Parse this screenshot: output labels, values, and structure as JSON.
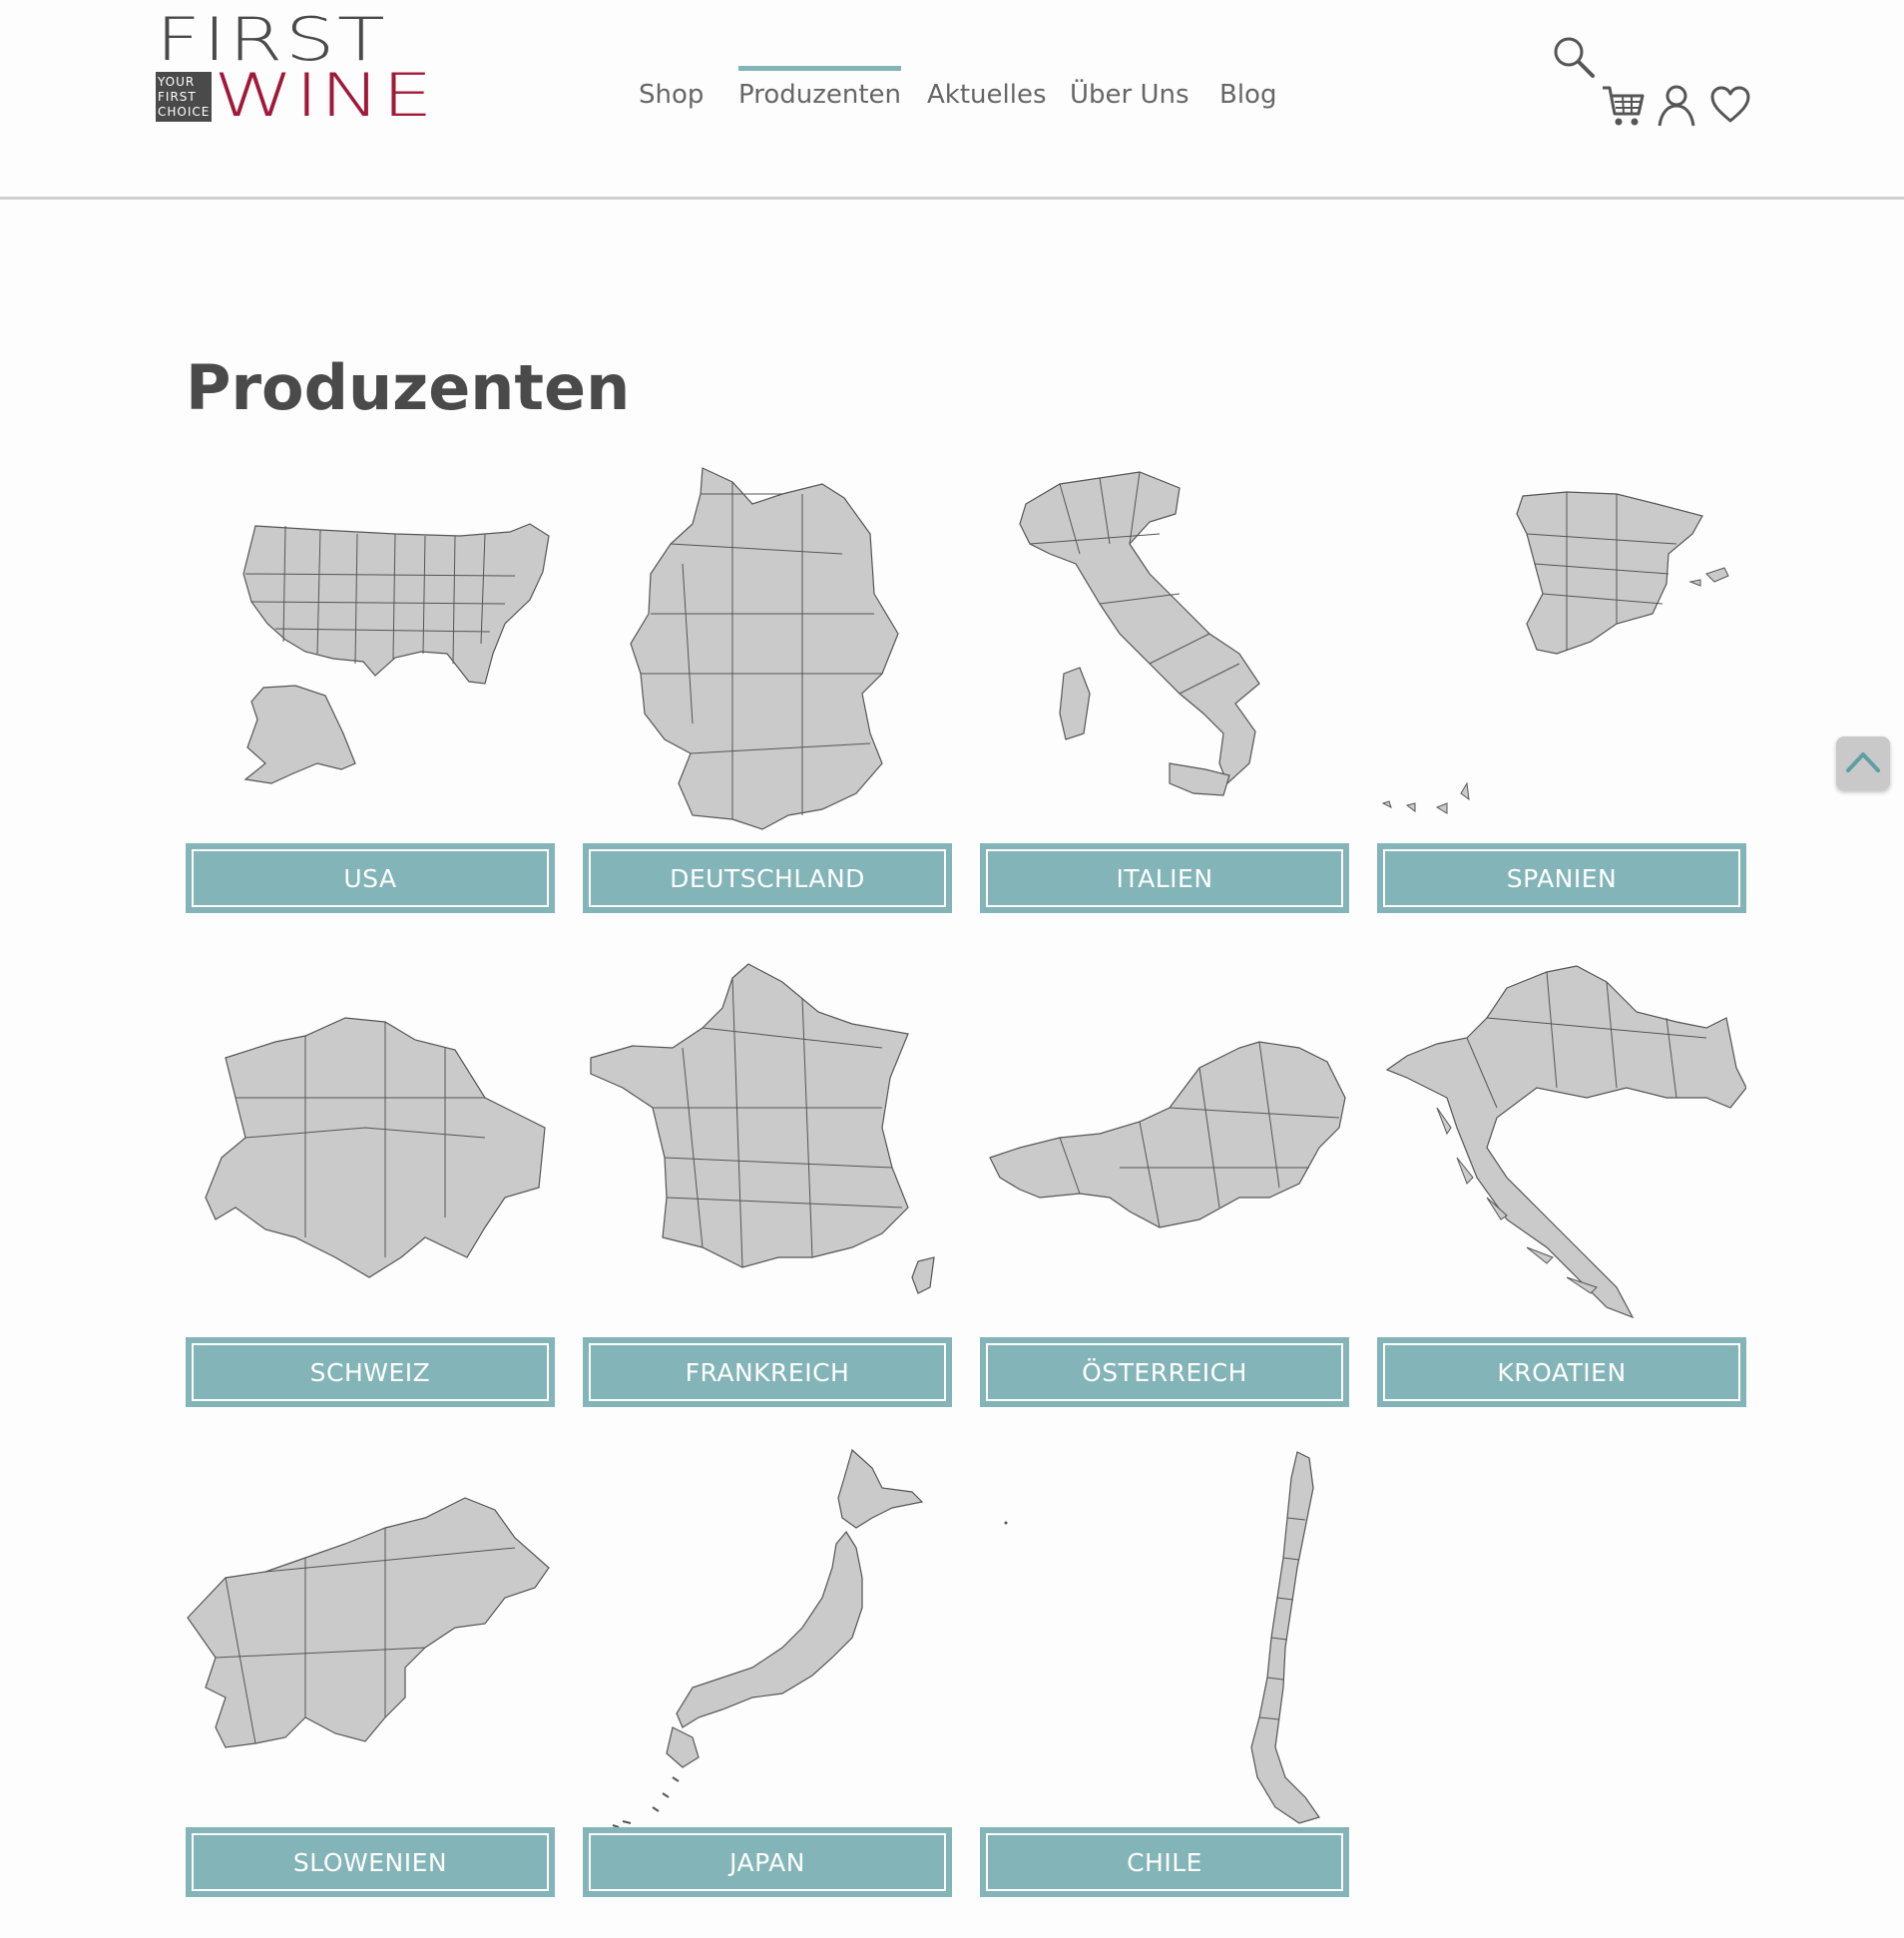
{
  "corner_toggle": {
    "label": "»"
  },
  "logo": {
    "first": "FIRST",
    "tagline": [
      "YOUR",
      "FIRST",
      "CHOICE"
    ],
    "wine": "WINE"
  },
  "nav": {
    "items": [
      {
        "label": "Shop",
        "active": false
      },
      {
        "label": "Produzenten",
        "active": true
      },
      {
        "label": "Aktuelles",
        "active": false
      },
      {
        "label": "Über Uns",
        "active": false
      },
      {
        "label": "Blog",
        "active": false
      }
    ]
  },
  "header_icons": [
    "search-icon",
    "cart-icon",
    "user-icon",
    "heart-icon"
  ],
  "page": {
    "title": "Produzenten"
  },
  "countries": [
    {
      "label": "USA"
    },
    {
      "label": "DEUTSCHLAND"
    },
    {
      "label": "ITALIEN"
    },
    {
      "label": "SPANIEN"
    },
    {
      "label": "SCHWEIZ"
    },
    {
      "label": "FRANKREICH"
    },
    {
      "label": "ÖSTERREICH"
    },
    {
      "label": "KROATIEN"
    },
    {
      "label": "SLOWENIEN"
    },
    {
      "label": "JAPAN"
    },
    {
      "label": "CHILE"
    }
  ],
  "colors": {
    "accent": "#82b4b8",
    "wine_red": "#a01a38",
    "map_fill": "#cacaca",
    "map_stroke": "#555555"
  }
}
